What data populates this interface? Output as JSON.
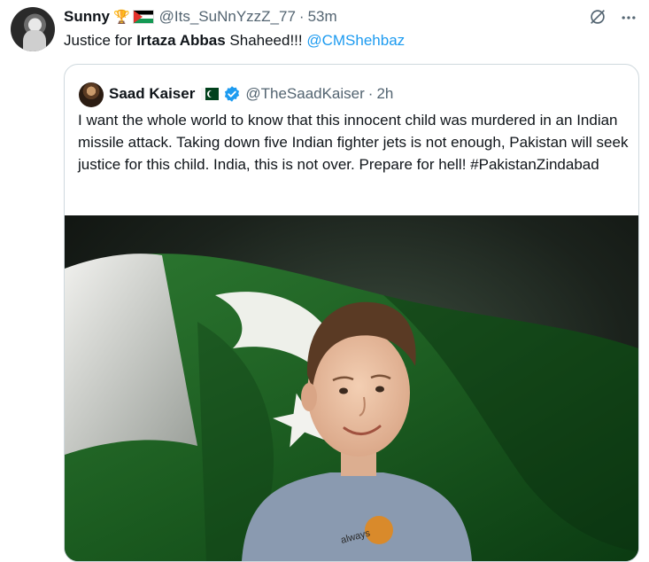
{
  "tweet": {
    "author_name": "Sunny",
    "handle": "@Its_SuNnYzzZ_77",
    "separator": "·",
    "time": "53m",
    "text_prefix": "Justice for ",
    "text_bold": "Irtaza Abbas",
    "text_suffix": " Shaheed!!! ",
    "mention": "@CMShehbaz",
    "icons": [
      "trophy-icon",
      "palestine-flag-icon",
      "grok-icon",
      "more-icon"
    ]
  },
  "quoted": {
    "author_name": "Saad Kaiser",
    "handle": "@TheSaadKaiser",
    "separator": "·",
    "time": "2h",
    "body": "I want the whole world to know that this innocent child was murdered in an Indian missile attack. Taking down five Indian fighter jets is not enough, Pakistan will seek justice for this child. India, this is not over. Prepare for hell!  #PakistanZindabad",
    "icons": [
      "pakistan-flag-icon",
      "verified-badge-icon"
    ],
    "media": {
      "tshirt_text": "always"
    }
  },
  "colors": {
    "text": "#0f1419",
    "secondary": "#536471",
    "link": "#1d9bf0",
    "border": "#cfd9de",
    "flag_green": "#01411c"
  }
}
